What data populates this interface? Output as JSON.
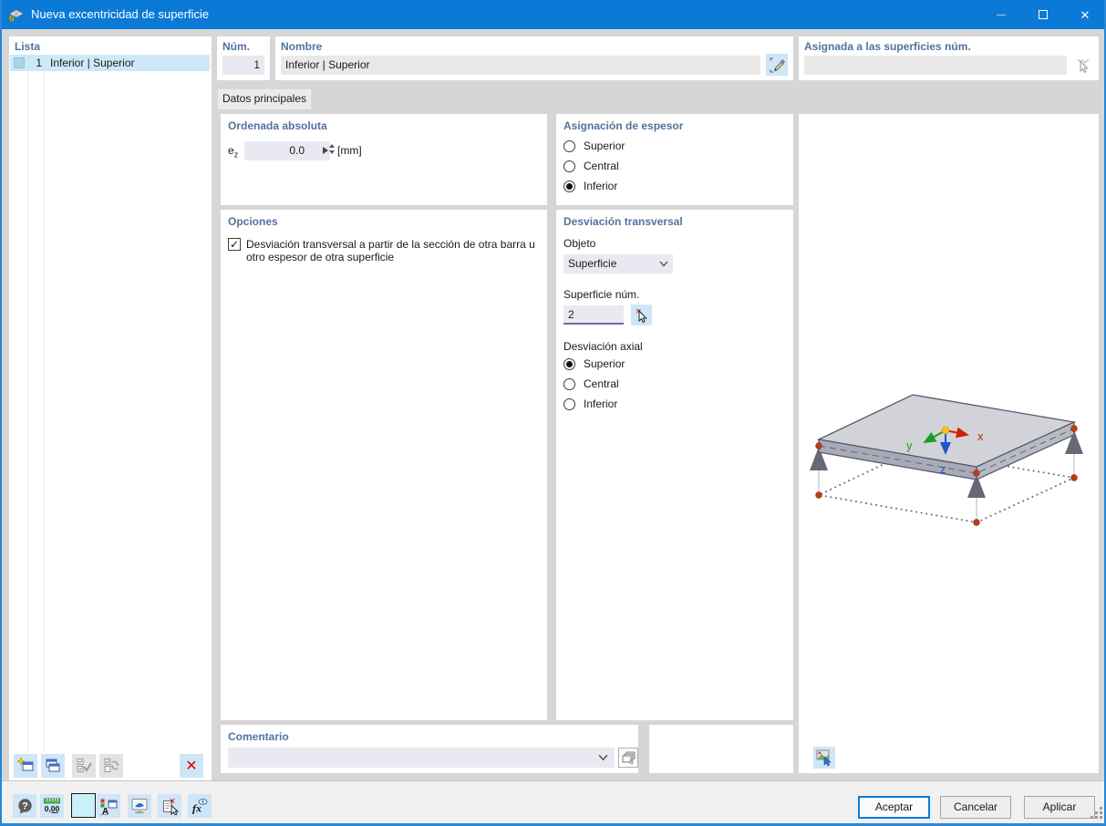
{
  "window": {
    "title": "Nueva excentricidad de superficie"
  },
  "icons": {
    "close": "✕",
    "check": "✓",
    "delete": "✕",
    "question": "?",
    "units": "0,00",
    "fx": "fx",
    "font_a": "A"
  },
  "lista": {
    "header": "Lista",
    "items": [
      {
        "number": "1",
        "name": "Inferior | Superior"
      }
    ]
  },
  "fields": {
    "num": {
      "label": "Núm.",
      "value": "1"
    },
    "nombre": {
      "label": "Nombre",
      "value": "Inferior | Superior"
    },
    "asignada": {
      "label": "Asignada a las superficies núm.",
      "value": ""
    }
  },
  "tabs": [
    {
      "label": "Datos principales"
    }
  ],
  "ordenada": {
    "header": "Ordenada absoluta",
    "ez_base": "e",
    "ez_sub": "z",
    "value": "0.0",
    "unit": "[mm]"
  },
  "asignacion": {
    "header": "Asignación de espesor",
    "options": [
      {
        "label": "Superior",
        "selected": false
      },
      {
        "label": "Central",
        "selected": false
      },
      {
        "label": "Inferior",
        "selected": true
      }
    ]
  },
  "opciones": {
    "header": "Opciones",
    "checkbox_label": "Desviación transversal a partir de la sección de otra barra u otro espesor de otra superficie",
    "checked": true
  },
  "desviacion": {
    "header": "Desviación transversal",
    "objeto_label": "Objeto",
    "objeto_value": "Superficie",
    "superficie_label": "Superficie núm.",
    "superficie_value": "2",
    "axial_label": "Desviación axial",
    "options": [
      {
        "label": "Superior",
        "selected": true
      },
      {
        "label": "Central",
        "selected": false
      },
      {
        "label": "Inferior",
        "selected": false
      }
    ]
  },
  "comentario": {
    "header": "Comentario",
    "value": ""
  },
  "preview": {
    "axis_x": "x",
    "axis_y": "y",
    "axis_z": "z"
  },
  "buttons": {
    "ok": "Aceptar",
    "cancel": "Cancelar",
    "apply": "Aplicar"
  },
  "colors": {
    "titlebar": "#0b7ad7",
    "accent": "#0078d7",
    "header_text": "#51749c",
    "field_lavender": "#e9e9f2",
    "field_gray": "#e9e9e9",
    "selection": "#cde9f8",
    "toolbar_button": "#cfe5f8",
    "axis_x": "#cc2200",
    "axis_y": "#1f9d1f",
    "axis_z": "#2255cc"
  }
}
